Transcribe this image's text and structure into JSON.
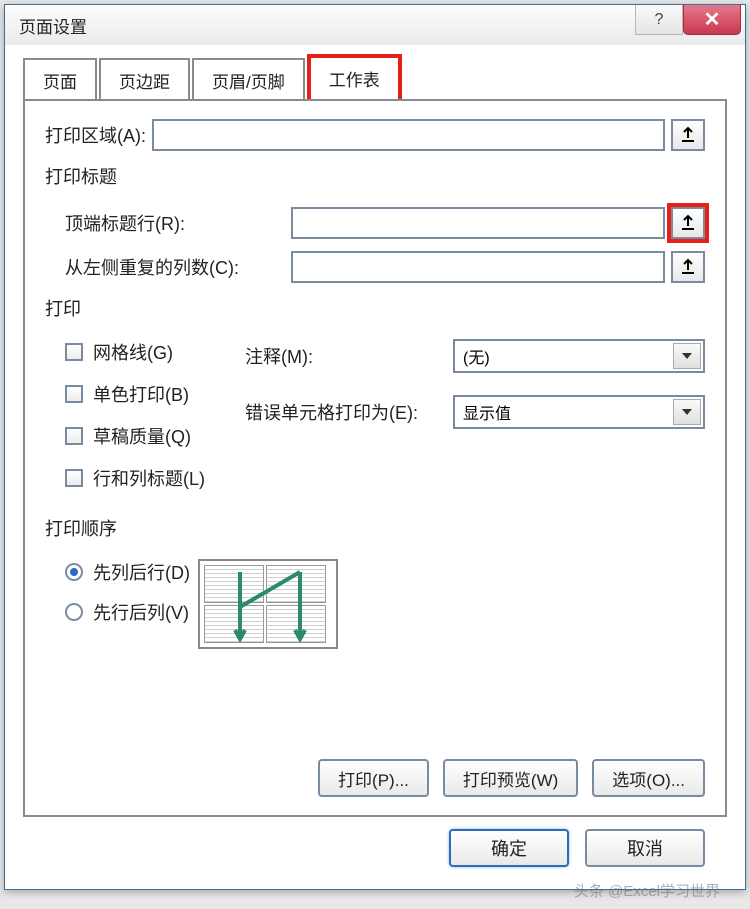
{
  "title": "页面设置",
  "tabs": {
    "page": "页面",
    "margins": "页边距",
    "header_footer": "页眉/页脚",
    "sheet": "工作表"
  },
  "print_area": {
    "label": "打印区域(A):",
    "value": ""
  },
  "print_titles": {
    "group": "打印标题",
    "top_rows": {
      "label": "顶端标题行(R):",
      "value": ""
    },
    "left_cols": {
      "label": "从左侧重复的列数(C):",
      "value": ""
    }
  },
  "print": {
    "group": "打印",
    "gridlines": "网格线(G)",
    "black_white": "单色打印(B)",
    "draft": "草稿质量(Q)",
    "row_col_headings": "行和列标题(L)",
    "comments_label": "注释(M):",
    "comments_value": "(无)",
    "errors_label": "错误单元格打印为(E):",
    "errors_value": "显示值"
  },
  "order": {
    "group": "打印顺序",
    "down_over": "先列后行(D)",
    "over_down": "先行后列(V)"
  },
  "buttons": {
    "print": "打印(P)...",
    "preview": "打印预览(W)",
    "options": "选项(O)...",
    "ok": "确定",
    "cancel": "取消"
  },
  "watermark": "头条 @Excel学习世界"
}
